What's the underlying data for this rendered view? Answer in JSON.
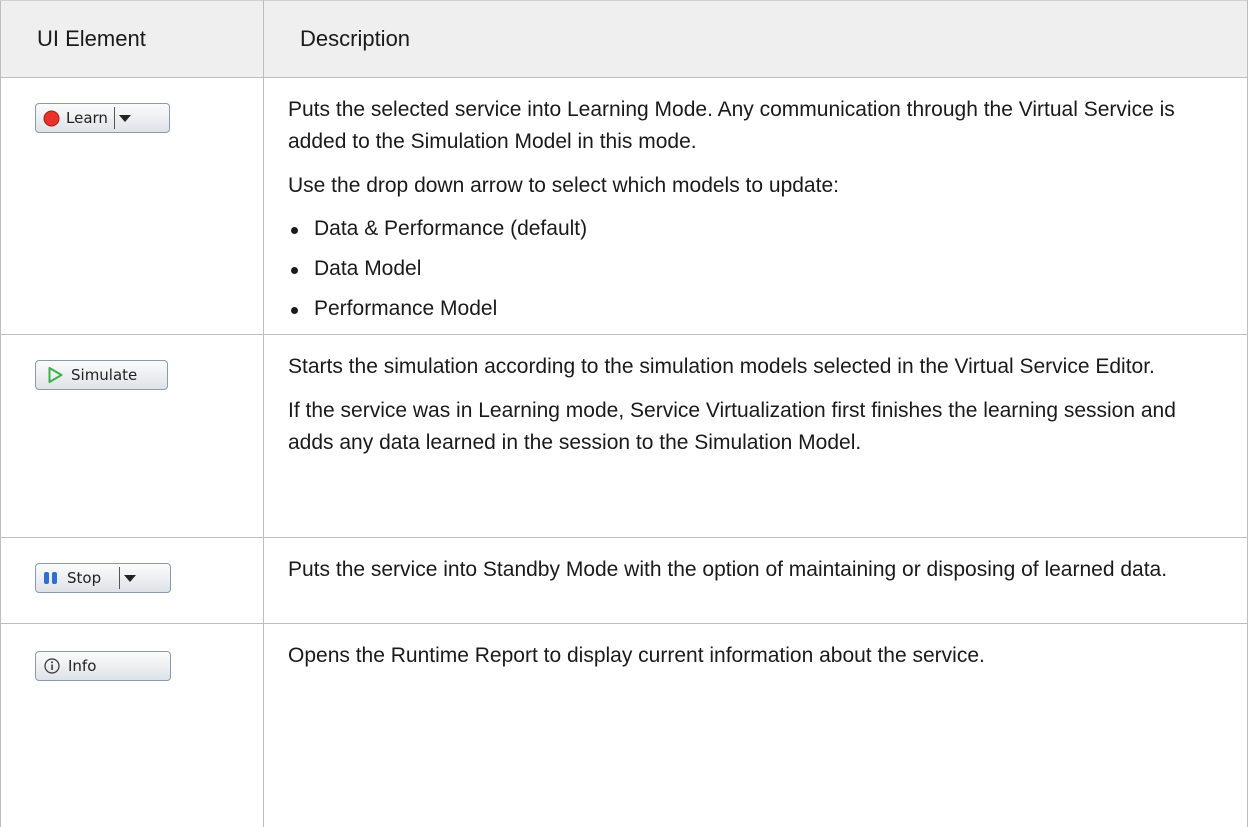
{
  "table": {
    "header": {
      "col1": "UI Element",
      "col2": "Description"
    },
    "rows": [
      {
        "button_label": "Learn",
        "button_icon": "record-icon",
        "has_dropdown": true,
        "paragraphs": [
          "Puts the selected service into Learning Mode. Any communication through the Virtual Service is added to the Simulation Model in this mode.",
          "Use the drop down arrow to select which models to update:"
        ],
        "bullets": [
          "Data & Performance (default)",
          "Data Model",
          "Performance Model"
        ]
      },
      {
        "button_label": "Simulate",
        "button_icon": "play-icon",
        "has_dropdown": false,
        "paragraphs": [
          "Starts the simulation according to the simulation models selected in the Virtual Service Editor.",
          "If the service was in Learning mode, Service Virtualization first finishes the learning session and adds any data learned in the session to the Simulation Model."
        ]
      },
      {
        "button_label": "Stop",
        "button_icon": "pause-icon",
        "has_dropdown": true,
        "paragraphs": [
          "Puts the service into Standby Mode with the option of maintaining or disposing of learned data."
        ]
      },
      {
        "button_label": "Info",
        "button_icon": "info-icon",
        "has_dropdown": false,
        "paragraphs": [
          "Opens the Runtime Report to display current information about the service."
        ]
      }
    ]
  },
  "colors": {
    "header_bg": "#efefef",
    "border": "#bdbdbd",
    "record_red": "#e8322a",
    "play_green": "#3fae49",
    "pause_blue": "#2e6fd0"
  }
}
